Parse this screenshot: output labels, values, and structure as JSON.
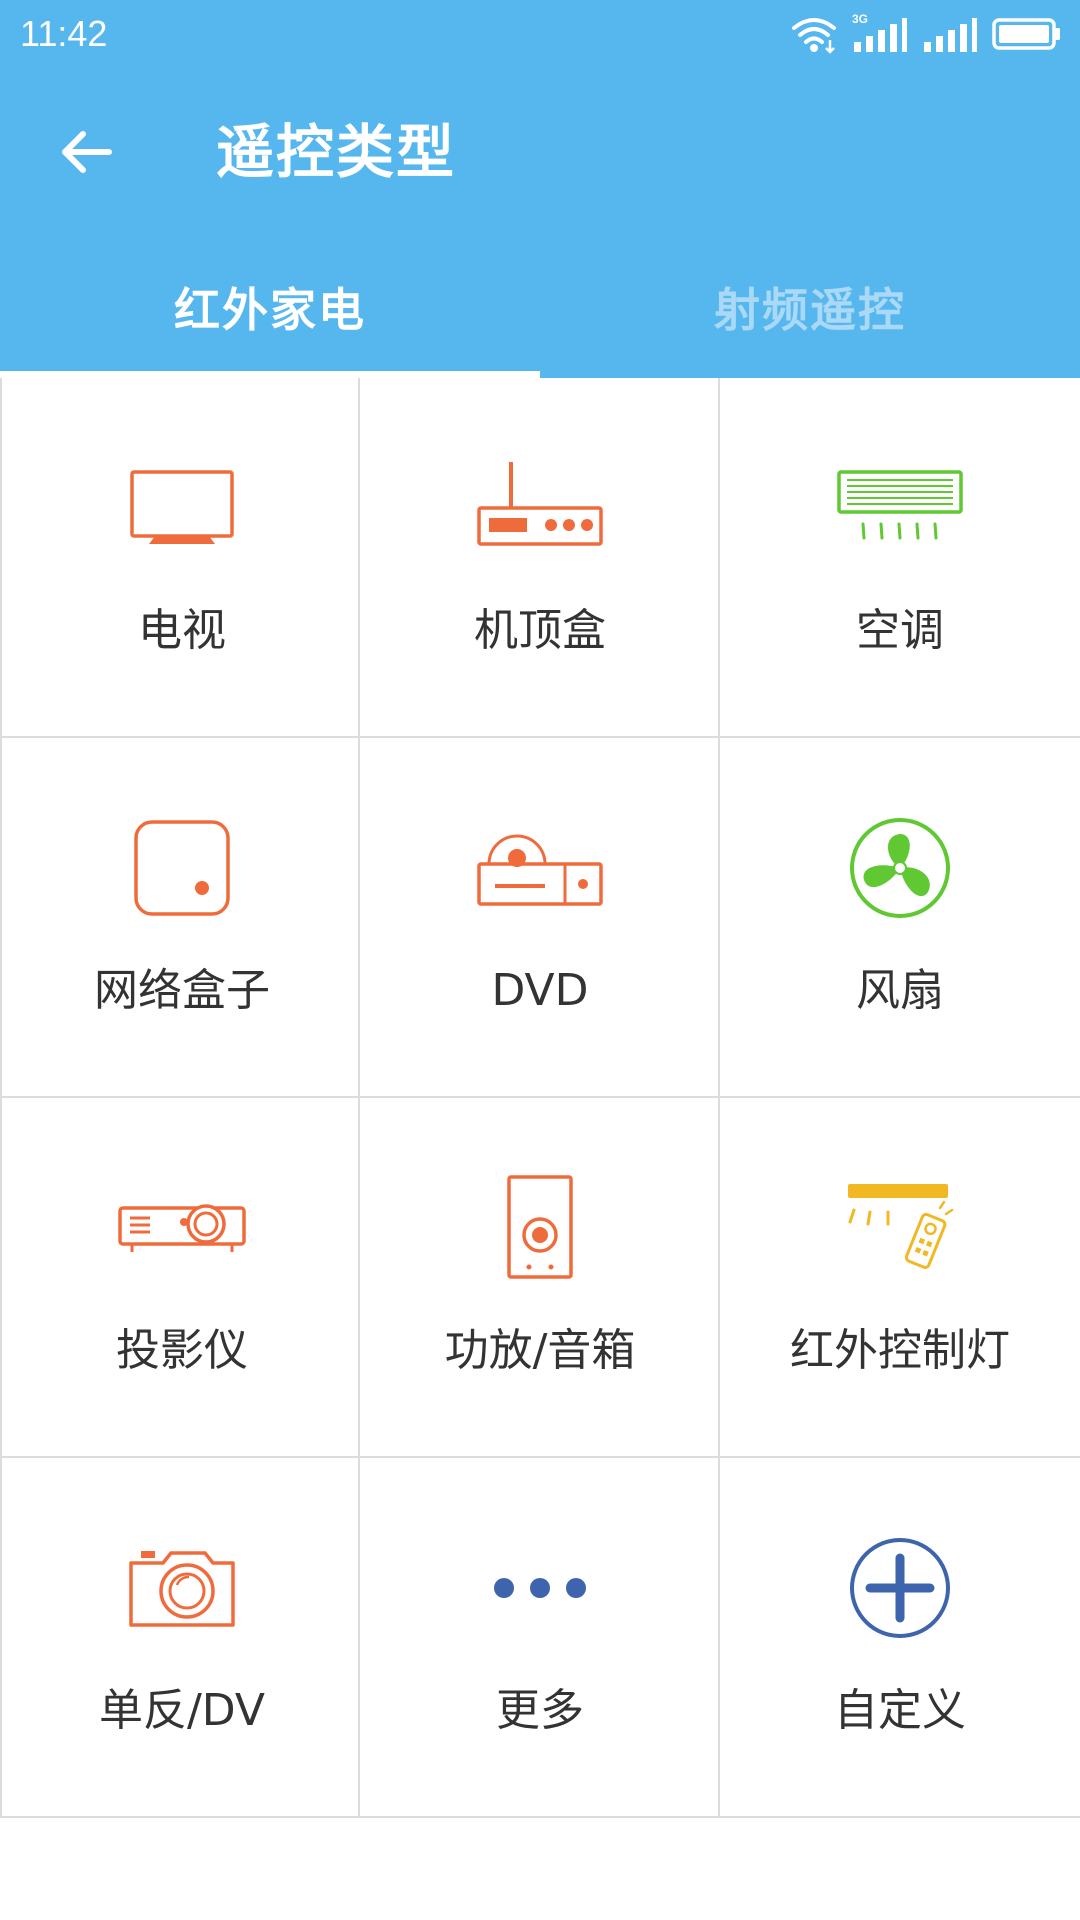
{
  "status_bar": {
    "time": "11:42",
    "network": "3G"
  },
  "header": {
    "title": "遥控类型",
    "back_icon": "arrow-left-icon"
  },
  "tabs": [
    {
      "label": "红外家电",
      "active": true
    },
    {
      "label": "射频遥控",
      "active": false
    }
  ],
  "devices": [
    {
      "label": "电视",
      "icon": "tv-icon"
    },
    {
      "label": "机顶盒",
      "icon": "set-top-box-icon"
    },
    {
      "label": "空调",
      "icon": "air-conditioner-icon"
    },
    {
      "label": "网络盒子",
      "icon": "network-box-icon"
    },
    {
      "label": "DVD",
      "icon": "dvd-player-icon"
    },
    {
      "label": "风扇",
      "icon": "fan-icon"
    },
    {
      "label": "投影仪",
      "icon": "projector-icon"
    },
    {
      "label": "功放/音箱",
      "icon": "speaker-icon"
    },
    {
      "label": "红外控制灯",
      "icon": "infrared-light-icon"
    },
    {
      "label": "单反/DV",
      "icon": "camera-icon"
    },
    {
      "label": "更多",
      "icon": "more-dots-icon"
    },
    {
      "label": "自定义",
      "icon": "add-circle-icon"
    }
  ],
  "colors": {
    "header_bg": "#56b6ee",
    "icon_orange": "#f06b3c",
    "icon_green": "#5fc832",
    "icon_yellow": "#f2b824",
    "icon_blue": "#3e64ad",
    "grid_line": "#dcdcdc",
    "label_text": "#333333"
  }
}
